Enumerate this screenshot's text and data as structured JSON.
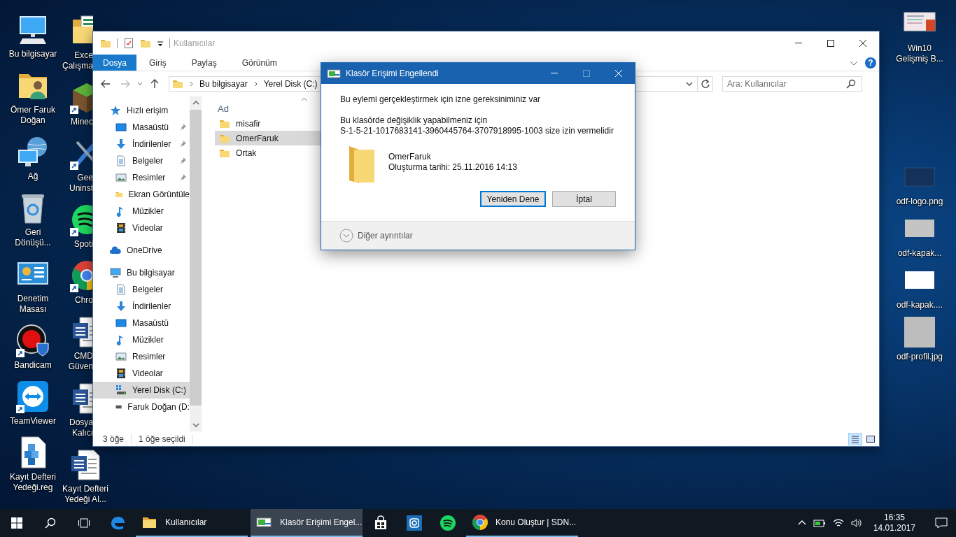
{
  "desktop": {
    "column_1": [
      {
        "kind": "computer",
        "lines": [
          "Bu bilgisayar"
        ],
        "shortcut": false,
        "partial": false
      },
      {
        "kind": "user-folder",
        "lines": [
          "Ömer Faruk",
          "Doğan"
        ],
        "shortcut": false,
        "partial": false
      },
      {
        "kind": "network",
        "lines": [
          "Ağ"
        ],
        "shortcut": false,
        "partial": false
      },
      {
        "kind": "recycle",
        "lines": [
          "Geri",
          "Dönüşü..."
        ],
        "shortcut": false,
        "partial": false
      },
      {
        "kind": "control-panel",
        "lines": [
          "Denetim",
          "Masası"
        ],
        "shortcut": false,
        "partial": false
      },
      {
        "kind": "record",
        "lines": [
          "Bandicam"
        ],
        "shortcut": true,
        "partial": false
      },
      {
        "kind": "remote",
        "lines": [
          "TeamViewer"
        ],
        "shortcut": true,
        "partial": false
      },
      {
        "kind": "registry",
        "lines": [
          "Kayıt Defteri",
          "Yedeği.reg"
        ],
        "shortcut": false,
        "partial": false
      }
    ],
    "column_2": [
      {
        "kind": "sheet-folder",
        "lines": [
          "Exce",
          "Çalışma"
        ],
        "shortcut": false,
        "partial": true
      },
      {
        "kind": "block",
        "lines": [
          "Minec"
        ],
        "shortcut": true,
        "partial": true
      },
      {
        "kind": "tools",
        "lines": [
          "Gee",
          "Uninst"
        ],
        "shortcut": true,
        "partial": true
      },
      {
        "kind": "music",
        "lines": [
          "Spoti"
        ],
        "shortcut": true,
        "partial": true
      },
      {
        "kind": "browser",
        "lines": [
          "Chro"
        ],
        "shortcut": true,
        "partial": true
      },
      {
        "kind": "document",
        "lines": [
          "CMD",
          "Güven"
        ],
        "shortcut": false,
        "partial": true
      },
      {
        "kind": "document",
        "lines": [
          "Dosya",
          "Kalıcı"
        ],
        "shortcut": false,
        "partial": true
      },
      {
        "kind": "document",
        "lines": [
          "Kayıt Defteri",
          "Yedeği Al..."
        ],
        "shortcut": false,
        "partial": false
      }
    ],
    "column_right": [
      {
        "kind": "slide",
        "lines": [
          "Win10",
          "Gelişmiş B..."
        ]
      },
      {
        "kind": "image-dark",
        "lines": [
          "odf-logo.png"
        ]
      },
      {
        "kind": "image-silver",
        "lines": [
          "odf-kapak..."
        ]
      },
      {
        "kind": "image-white",
        "lines": [
          "odf-kapak...."
        ]
      },
      {
        "kind": "image-square",
        "lines": [
          "odf-profil.jpg"
        ]
      }
    ]
  },
  "explorer": {
    "title": "Kullanıcılar",
    "ribbon_tabs": [
      {
        "label": "Dosya",
        "selected": true
      },
      {
        "label": "Giriş",
        "selected": false
      },
      {
        "label": "Paylaş",
        "selected": false
      },
      {
        "label": "Görünüm",
        "selected": false
      }
    ],
    "help": "?",
    "address": [
      "Bu bilgisayar",
      "Yerel Disk (C:)"
    ],
    "search": {
      "placeholder": "Ara: Kullanıcılar"
    },
    "nav": [
      {
        "label": "Hızlı erişim",
        "kind": "star",
        "selected": false,
        "children": [
          {
            "label": "Masaüstü",
            "kind": "desktop",
            "pinned": true,
            "selected": false
          },
          {
            "label": "İndirilenler",
            "kind": "download",
            "pinned": true,
            "selected": false
          },
          {
            "label": "Belgeler",
            "kind": "documents",
            "pinned": true,
            "selected": false
          },
          {
            "label": "Resimler",
            "kind": "pictures",
            "pinned": true,
            "selected": false
          },
          {
            "label": "Ekran Görüntüle",
            "kind": "folder",
            "pinned": false,
            "selected": false
          },
          {
            "label": "Müzikler",
            "kind": "music",
            "pinned": false,
            "selected": false
          },
          {
            "label": "Videolar",
            "kind": "videos",
            "pinned": false,
            "selected": false
          }
        ]
      },
      {
        "label": "OneDrive",
        "kind": "cloud",
        "selected": false
      },
      {
        "label": "Bu bilgisayar",
        "kind": "computer",
        "selected": false,
        "children": [
          {
            "label": "Belgeler",
            "kind": "documents",
            "pinned": false,
            "selected": false
          },
          {
            "label": "İndirilenler",
            "kind": "download",
            "pinned": false,
            "selected": false
          },
          {
            "label": "Masaüstü",
            "kind": "desktop",
            "pinned": false,
            "selected": false
          },
          {
            "label": "Müzikler",
            "kind": "music",
            "pinned": false,
            "selected": false
          },
          {
            "label": "Resimler",
            "kind": "pictures",
            "pinned": false,
            "selected": false
          },
          {
            "label": "Videolar",
            "kind": "videos",
            "pinned": false,
            "selected": false
          },
          {
            "label": "Yerel Disk (C:)",
            "kind": "system-drive",
            "pinned": false,
            "selected": true
          },
          {
            "label": "Faruk Doğan (D:",
            "kind": "drive",
            "pinned": false,
            "selected": false
          }
        ]
      }
    ],
    "column": "Ad",
    "files": [
      {
        "name": "misafir",
        "selected": false
      },
      {
        "name": "OmerFaruk",
        "selected": true
      },
      {
        "name": "Ortak",
        "selected": false
      }
    ],
    "status": {
      "count": "3 öğe",
      "selection": "1 öğe seçildi"
    },
    "views": [
      {
        "kind": "details",
        "selected": true
      },
      {
        "kind": "large-icons",
        "selected": false
      }
    ]
  },
  "dialog": {
    "title": "Klasör Erişimi Engellendi",
    "message": "Bu eylemi gerçekleştirmek için izne gereksiniminiz var",
    "detail_lines": [
      "Bu klasörde değişiklik yapabilmeniz için",
      "S-1-5-21-1017683141-3960445764-3707918995-1003 size izin vermelidir"
    ],
    "folder_name": "OmerFaruk",
    "folder_date": "Oluşturma tarihi: 25.11.2016 14:13",
    "buttons": [
      {
        "label": "Yeniden Dene",
        "default": true
      },
      {
        "label": "İptal",
        "default": false
      }
    ],
    "more": "Diğer ayrıntılar"
  },
  "taskbar": {
    "apps": [
      {
        "kind": "edge",
        "running": false,
        "selected": false
      },
      {
        "kind": "folder",
        "label": "Kullanıcılar",
        "running": true,
        "selected": false
      },
      {
        "kind": "dialog",
        "label": "Klasör Erişimi Engel...",
        "running": true,
        "selected": true
      },
      {
        "kind": "store",
        "running": false,
        "selected": false
      },
      {
        "kind": "instagram",
        "running": false,
        "selected": false
      },
      {
        "kind": "music",
        "running": false,
        "selected": false
      },
      {
        "kind": "browser",
        "label": "Konu Oluştur | SDN...",
        "running": true,
        "selected": false
      }
    ],
    "time": "16:35",
    "date": "14.01.2017"
  }
}
